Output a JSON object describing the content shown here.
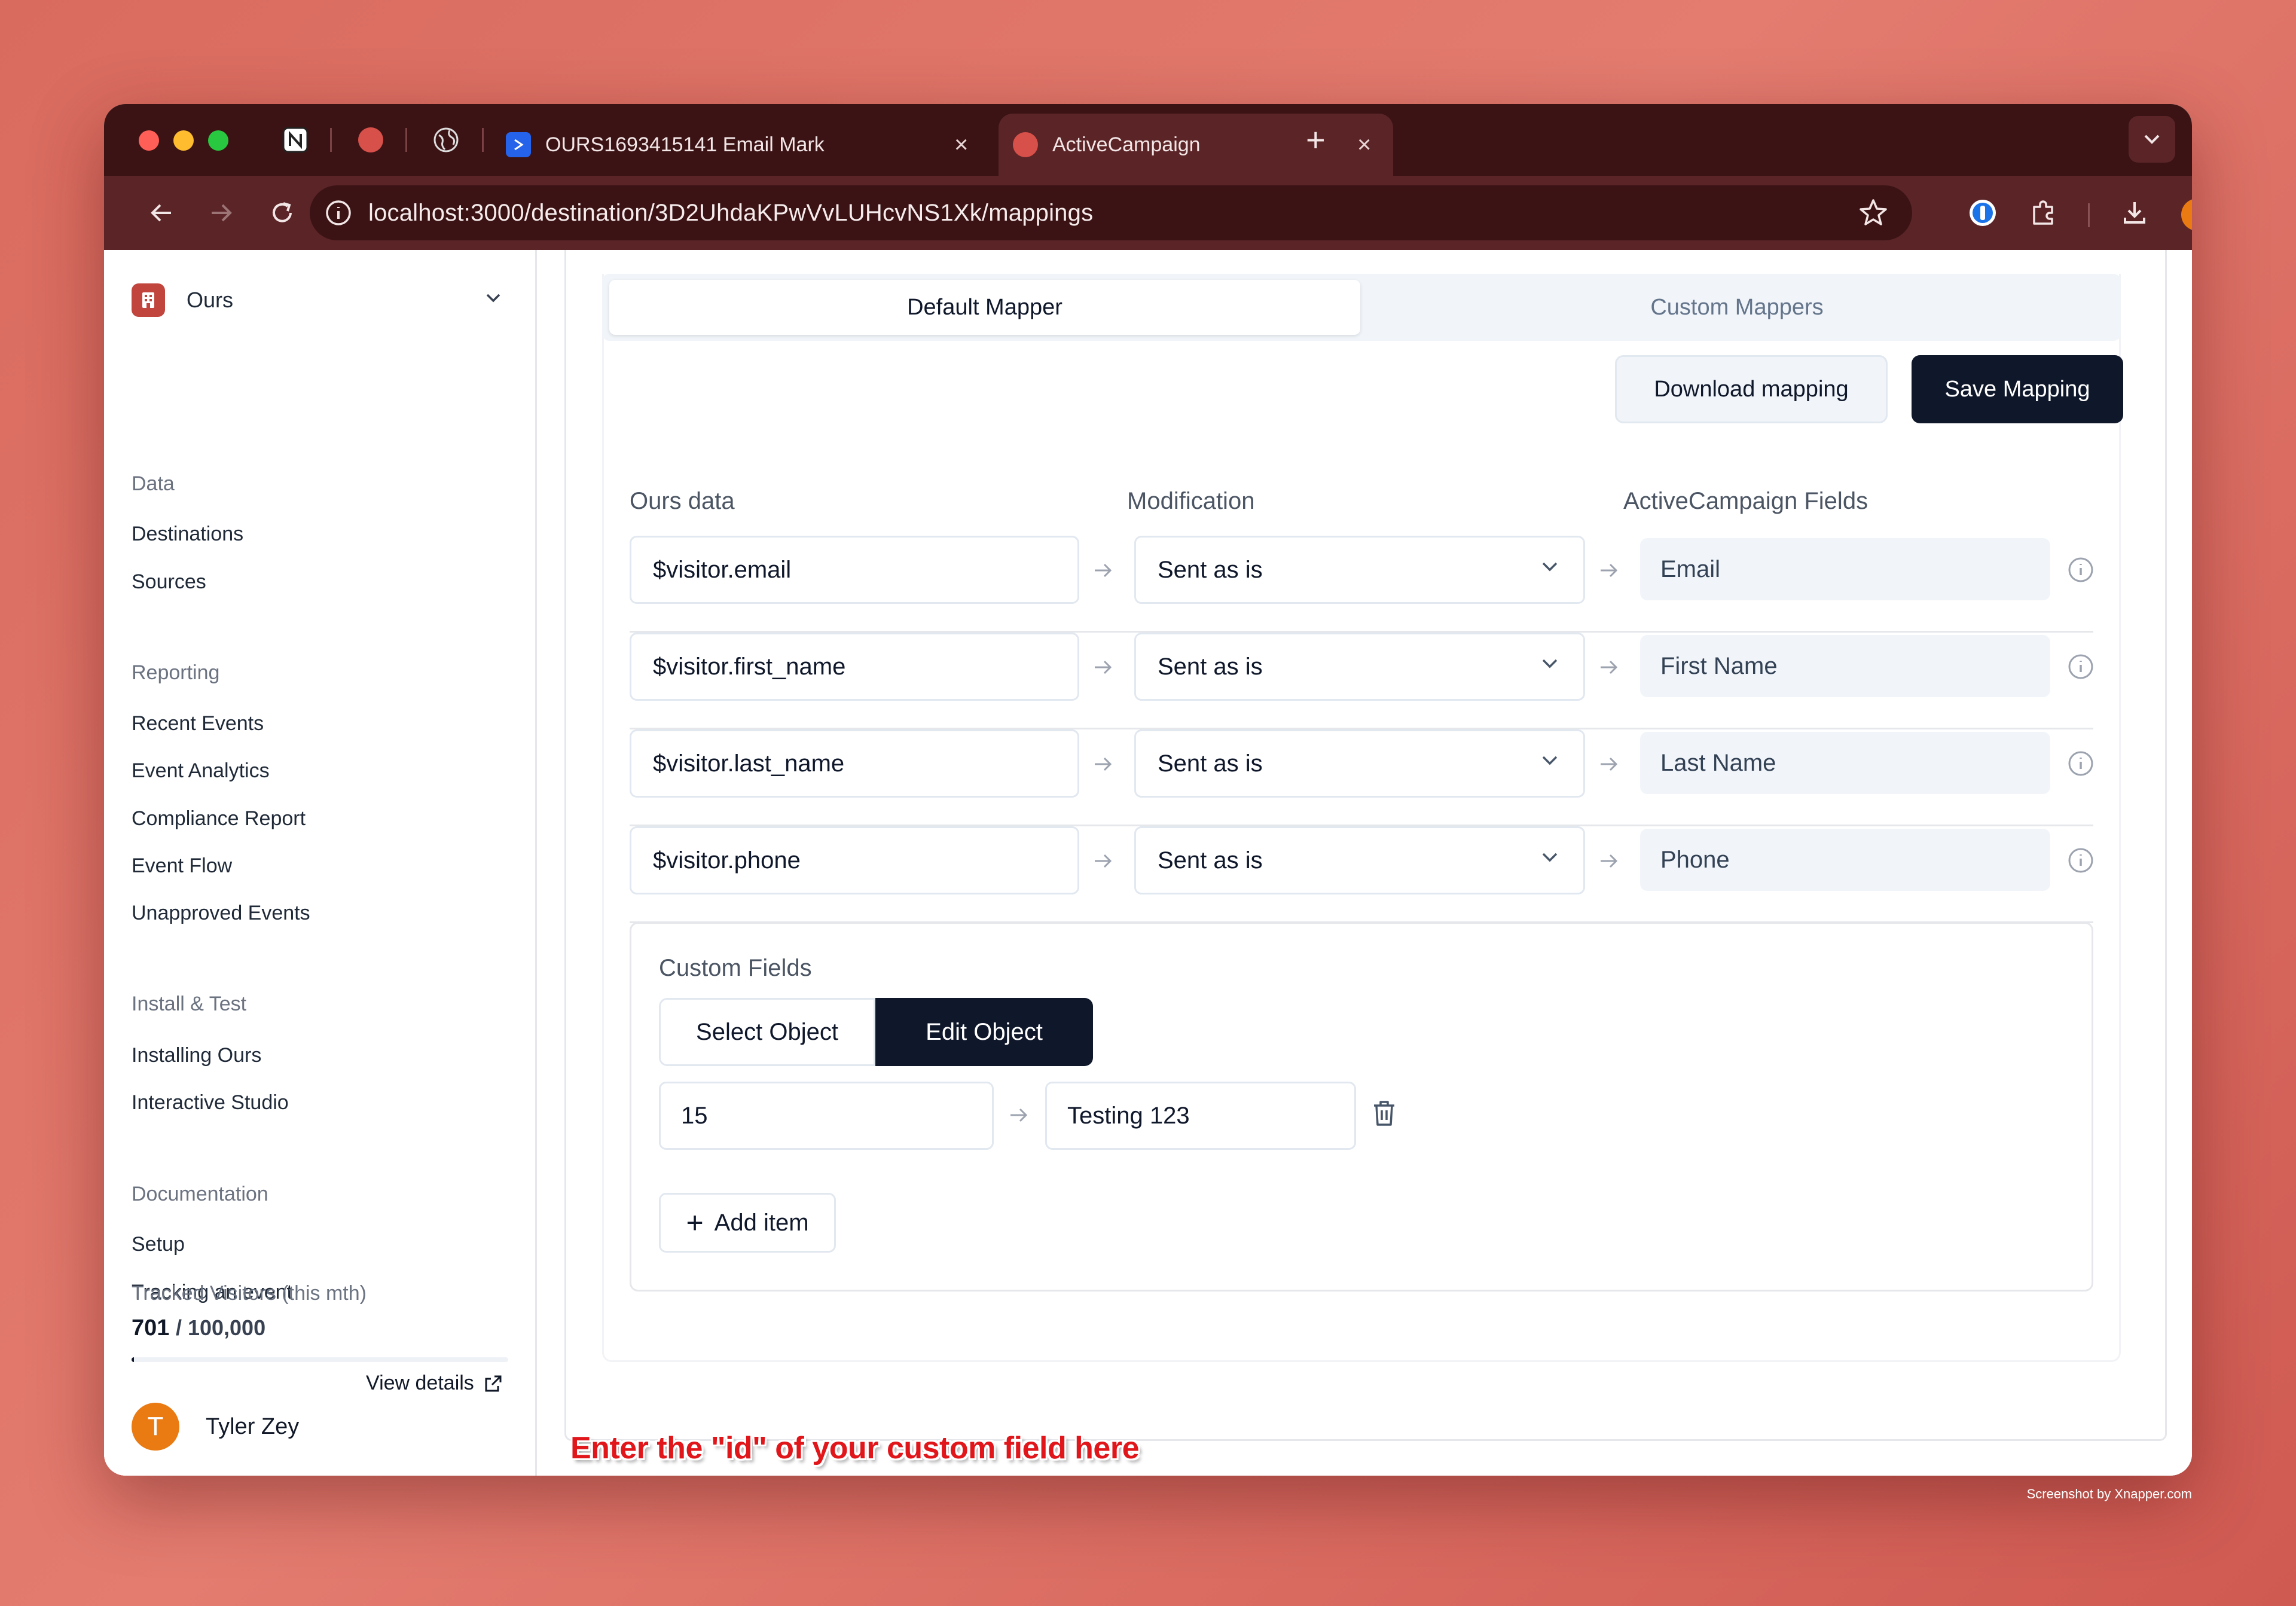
{
  "browser": {
    "tabs": [
      {
        "title": "OURS1693415141 Email Mark",
        "active": false
      },
      {
        "title": "ActiveCampaign",
        "active": true
      }
    ],
    "url": "localhost:3000/destination/3D2UhdaKPwVvLUHcvNS1Xk/mappings",
    "profile_initial": "T"
  },
  "sidebar": {
    "org_name": "Ours",
    "sections": [
      {
        "title": "Data",
        "items": [
          "Destinations",
          "Sources"
        ]
      },
      {
        "title": "Reporting",
        "items": [
          "Recent Events",
          "Event Analytics",
          "Compliance Report",
          "Event Flow",
          "Unapproved Events"
        ]
      },
      {
        "title": "Install & Test",
        "items": [
          "Installing Ours",
          "Interactive Studio"
        ]
      },
      {
        "title": "Documentation",
        "items": [
          "Setup",
          "Tracking an event"
        ]
      }
    ],
    "usage": {
      "label": "Tracked Visitors (this mth)",
      "count": "701",
      "limit": "/ 100,000",
      "fraction": 0.007
    },
    "view_details": "View details",
    "user": {
      "initial": "T",
      "name": "Tyler Zey"
    }
  },
  "main": {
    "tabs": {
      "default": "Default Mapper",
      "custom": "Custom Mappers"
    },
    "download_label": "Download mapping",
    "save_label": "Save Mapping",
    "columns": {
      "source": "Ours data",
      "modification": "Modification",
      "destination": "ActiveCampaign Fields"
    },
    "rows": [
      {
        "source": "$visitor.email",
        "modification": "Sent as is",
        "destination": "Email"
      },
      {
        "source": "$visitor.first_name",
        "modification": "Sent as is",
        "destination": "First Name"
      },
      {
        "source": "$visitor.last_name",
        "modification": "Sent as is",
        "destination": "Last Name"
      },
      {
        "source": "$visitor.phone",
        "modification": "Sent as is",
        "destination": "Phone"
      }
    ],
    "custom_fields": {
      "title": "Custom Fields",
      "select_object": "Select Object",
      "edit_object": "Edit Object",
      "item_key": "15",
      "item_value": "Testing 123",
      "add_item": "Add item"
    }
  },
  "annotation": "Enter the \"id\" of your custom field here",
  "credit": "Screenshot by Xnapper.com",
  "colors": {
    "accent": "#0f172a",
    "annotation": "#e0161b",
    "avatar": "#ea7a12",
    "logo": "#c1443d"
  }
}
